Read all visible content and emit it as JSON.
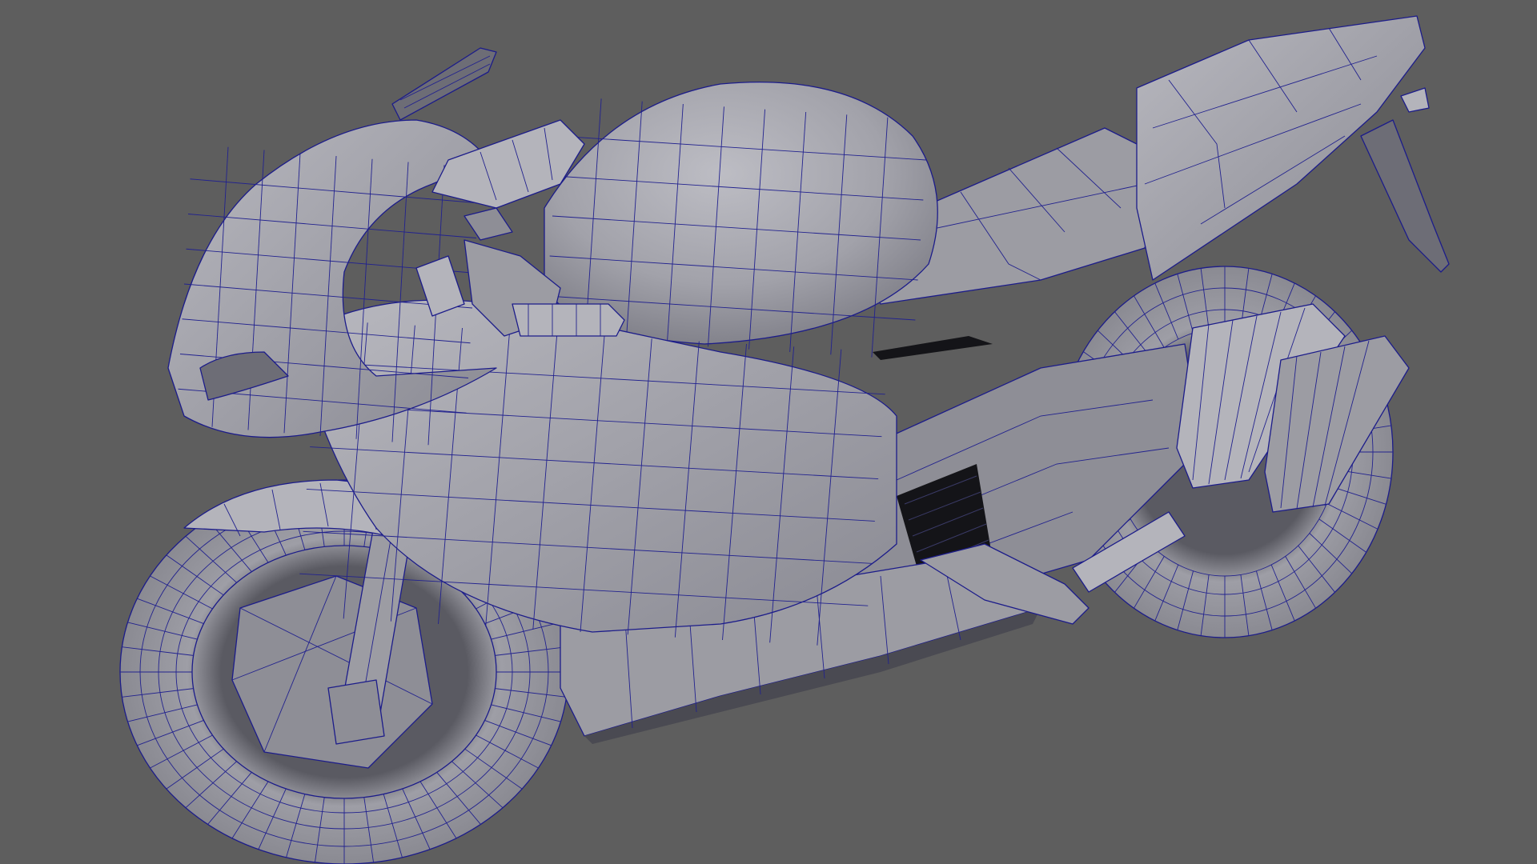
{
  "viewport": {
    "background_color": "#5e5e5e",
    "wireframe_color": "#1c1c8a",
    "shaded_color": "#a0a0a8"
  }
}
